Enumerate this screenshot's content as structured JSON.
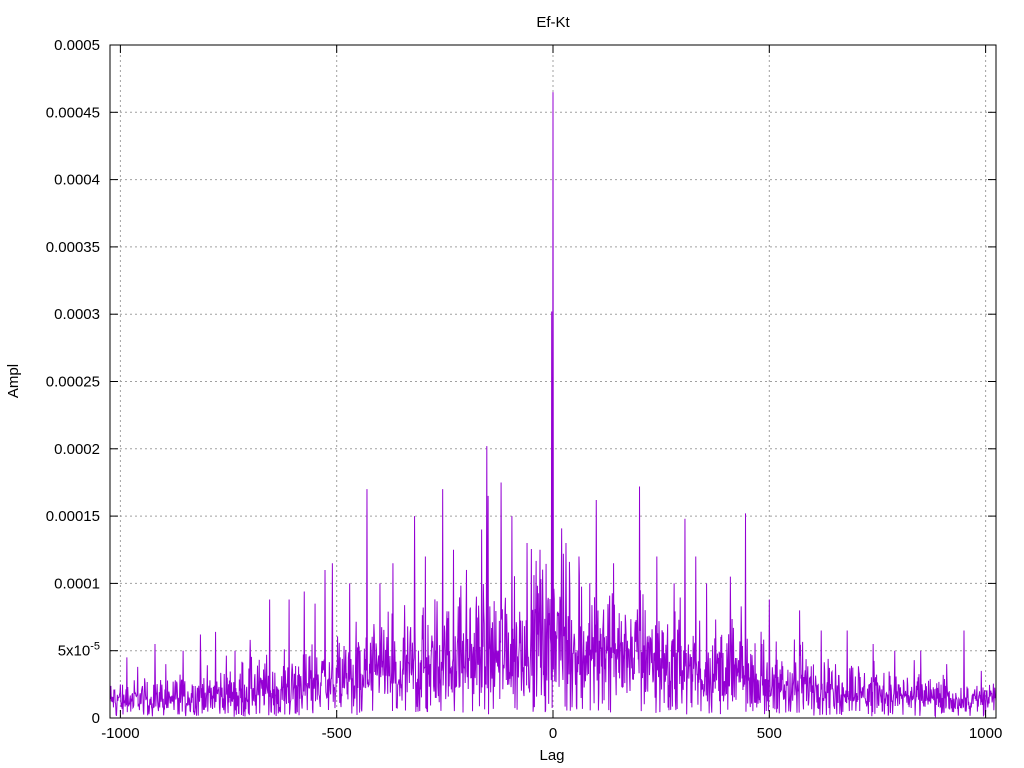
{
  "chart_data": {
    "type": "line",
    "title": "Ef-Kt",
    "xlabel": "Lag",
    "ylabel": "Ampl",
    "xlim": [
      -1024,
      1024
    ],
    "ylim": [
      0,
      0.0005
    ],
    "grid": true,
    "x_ticks": [
      {
        "value": -1000,
        "label": "-1000"
      },
      {
        "value": -500,
        "label": "-500"
      },
      {
        "value": 0,
        "label": "0"
      },
      {
        "value": 500,
        "label": "500"
      },
      {
        "value": 1000,
        "label": "1000"
      }
    ],
    "y_ticks": [
      {
        "value": 0,
        "label": "0",
        "sup": ""
      },
      {
        "value": 5e-05,
        "label": "5x10",
        "sup": "-5"
      },
      {
        "value": 0.0001,
        "label": "0.0001",
        "sup": ""
      },
      {
        "value": 0.00015,
        "label": "0.00015",
        "sup": ""
      },
      {
        "value": 0.0002,
        "label": "0.0002",
        "sup": ""
      },
      {
        "value": 0.00025,
        "label": "0.00025",
        "sup": ""
      },
      {
        "value": 0.0003,
        "label": "0.0003",
        "sup": ""
      },
      {
        "value": 0.00035,
        "label": "0.00035",
        "sup": ""
      },
      {
        "value": 0.0004,
        "label": "0.0004",
        "sup": ""
      },
      {
        "value": 0.00045,
        "label": "0.00045",
        "sup": ""
      },
      {
        "value": 0.0005,
        "label": "0.0005",
        "sup": ""
      }
    ],
    "series": [
      {
        "color": "#9400d3",
        "peaks": [
          {
            "x": -1000,
            "y": 2.5e-05
          },
          {
            "x": -985,
            "y": 4.5e-05
          },
          {
            "x": -960,
            "y": 3.8e-05
          },
          {
            "x": -920,
            "y": 5.5e-05
          },
          {
            "x": -895,
            "y": 4e-05
          },
          {
            "x": -855,
            "y": 5e-05
          },
          {
            "x": -815,
            "y": 6.2e-05
          },
          {
            "x": -780,
            "y": 6.4e-05
          },
          {
            "x": -735,
            "y": 5e-05
          },
          {
            "x": -700,
            "y": 5.8e-05
          },
          {
            "x": -655,
            "y": 8.8e-05
          },
          {
            "x": -610,
            "y": 8.8e-05
          },
          {
            "x": -575,
            "y": 9.4e-05
          },
          {
            "x": -550,
            "y": 8.5e-05
          },
          {
            "x": -527,
            "y": 0.00011
          },
          {
            "x": -510,
            "y": 0.000115
          },
          {
            "x": -470,
            "y": 0.0001
          },
          {
            "x": -430,
            "y": 0.00017
          },
          {
            "x": -400,
            "y": 0.0001
          },
          {
            "x": -370,
            "y": 0.000115
          },
          {
            "x": -320,
            "y": 0.00015
          },
          {
            "x": -295,
            "y": 0.00012
          },
          {
            "x": -255,
            "y": 0.00017
          },
          {
            "x": -230,
            "y": 0.000125
          },
          {
            "x": -200,
            "y": 0.00011
          },
          {
            "x": -165,
            "y": 0.00014
          },
          {
            "x": -153,
            "y": 0.000202
          },
          {
            "x": -150,
            "y": 0.000165
          },
          {
            "x": -120,
            "y": 0.000175
          },
          {
            "x": -95,
            "y": 0.00015
          },
          {
            "x": -60,
            "y": 0.00013
          },
          {
            "x": -30,
            "y": 0.000125
          },
          {
            "x": -3,
            "y": 0.000302
          },
          {
            "x": 0,
            "y": 0.000465
          },
          {
            "x": 30,
            "y": 0.00013
          },
          {
            "x": 60,
            "y": 0.00012
          },
          {
            "x": 100,
            "y": 0.000162
          },
          {
            "x": 140,
            "y": 0.000115
          },
          {
            "x": 200,
            "y": 0.000172
          },
          {
            "x": 240,
            "y": 0.00012
          },
          {
            "x": 280,
            "y": 0.0001
          },
          {
            "x": 305,
            "y": 0.000148
          },
          {
            "x": 330,
            "y": 0.00012
          },
          {
            "x": 355,
            "y": 0.0001
          },
          {
            "x": 410,
            "y": 0.000105
          },
          {
            "x": 445,
            "y": 0.000152
          },
          {
            "x": 500,
            "y": 8.8e-05
          },
          {
            "x": 570,
            "y": 8e-05
          },
          {
            "x": 620,
            "y": 6.5e-05
          },
          {
            "x": 680,
            "y": 6.5e-05
          },
          {
            "x": 740,
            "y": 5.5e-05
          },
          {
            "x": 790,
            "y": 5e-05
          },
          {
            "x": 850,
            "y": 5e-05
          },
          {
            "x": 910,
            "y": 4e-05
          },
          {
            "x": 950,
            "y": 6.5e-05
          },
          {
            "x": 990,
            "y": 3.5e-05
          }
        ]
      }
    ]
  }
}
